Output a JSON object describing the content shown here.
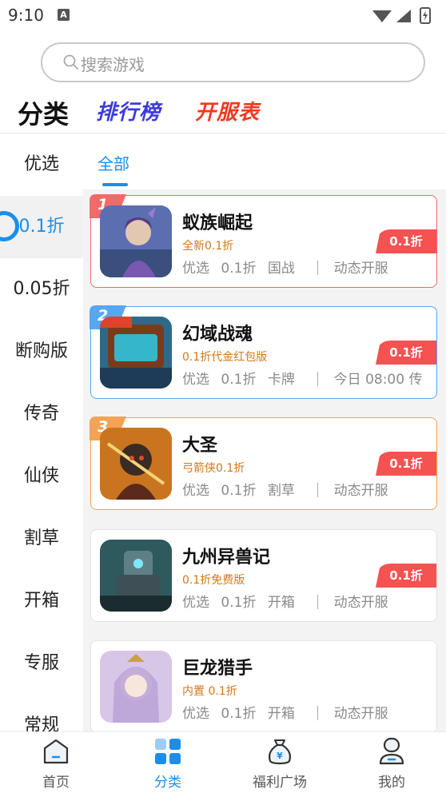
{
  "status": {
    "time": "9:10",
    "notif_letter": "A"
  },
  "search": {
    "placeholder": "搜索游戏"
  },
  "top_tabs": {
    "category": "分类",
    "rank": "排行榜",
    "open": "开服表"
  },
  "sidebar": {
    "items": [
      {
        "label": "优选"
      },
      {
        "label": "0.1折"
      },
      {
        "label": "0.05折"
      },
      {
        "label": "断购版"
      },
      {
        "label": "传奇"
      },
      {
        "label": "仙侠"
      },
      {
        "label": "割草"
      },
      {
        "label": "开箱"
      },
      {
        "label": "专服"
      },
      {
        "label": "常规"
      }
    ],
    "active_index": 1
  },
  "content_tabs": {
    "all": "全部"
  },
  "games": [
    {
      "rank": "1",
      "name": "蚁族崛起",
      "subtitle": "全新0.1折",
      "tags": [
        "优选",
        "0.1折",
        "国战"
      ],
      "server": "动态开服",
      "discount": "0.1折"
    },
    {
      "rank": "2",
      "name": "幻域战魂",
      "subtitle": "0.1折代金红包版",
      "tags": [
        "优选",
        "0.1折",
        "卡牌"
      ],
      "server": "今日 08:00 传…",
      "discount": "0.1折"
    },
    {
      "rank": "3",
      "name": "大圣",
      "subtitle": "弓箭侠0.1折",
      "tags": [
        "优选",
        "0.1折",
        "割草"
      ],
      "server": "动态开服",
      "discount": "0.1折"
    },
    {
      "rank": "",
      "name": "九州异兽记",
      "subtitle": "0.1折免费版",
      "tags": [
        "优选",
        "0.1折",
        "开箱"
      ],
      "server": "动态开服",
      "discount": "0.1折"
    },
    {
      "rank": "",
      "name": "巨龙猎手",
      "subtitle": "内置 0.1折",
      "tags": [
        "优选",
        "0.1折",
        "开箱"
      ],
      "server": "动态开服",
      "discount": ""
    }
  ],
  "bottom_nav": {
    "items": [
      {
        "label": "首页",
        "icon": "home-icon"
      },
      {
        "label": "分类",
        "icon": "category-icon"
      },
      {
        "label": "福利广场",
        "icon": "money-bag-icon"
      },
      {
        "label": "我的",
        "icon": "profile-icon"
      }
    ],
    "active_index": 1
  },
  "colors": {
    "accent": "#1c8ee8",
    "discount": "#f55252",
    "rank1": "#f06a6a",
    "rank2": "#57a7f3",
    "rank3": "#f3a356"
  }
}
